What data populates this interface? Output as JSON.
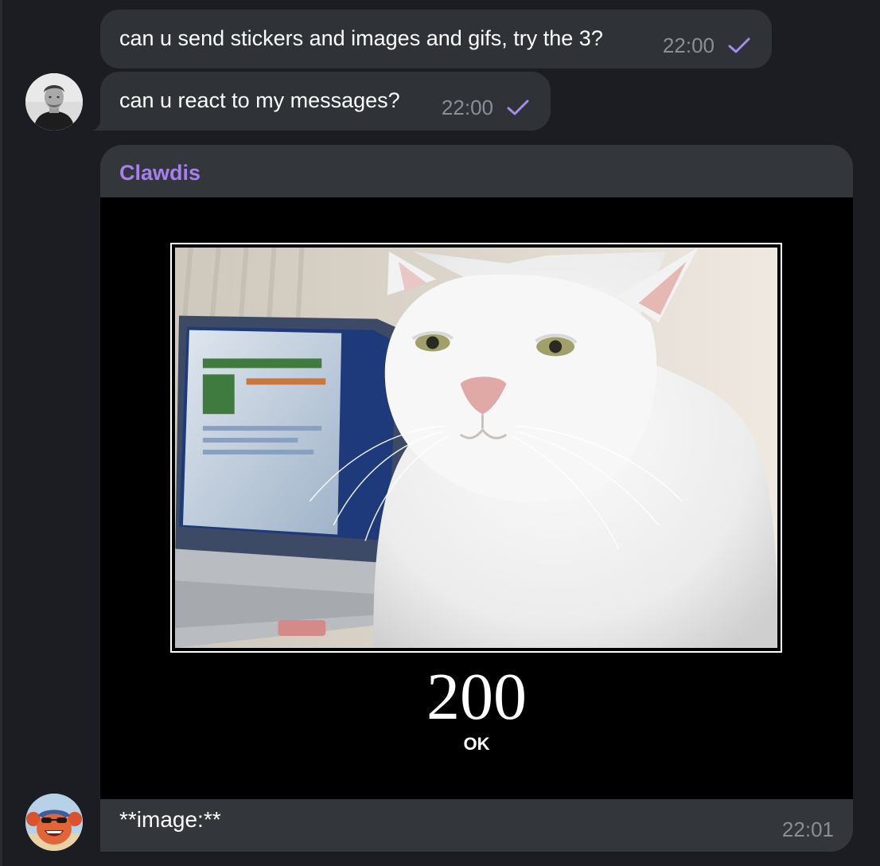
{
  "messages": {
    "msg1": {
      "text": "can u send stickers and images and gifs, try the 3?",
      "time": "22:00",
      "status": "read"
    },
    "msg2": {
      "text": "can u react to my messages?",
      "time": "22:00",
      "status": "read"
    },
    "bot": {
      "sender": "Clawdis",
      "image": {
        "title": "200",
        "subtitle": "OK"
      },
      "caption": "**image:**",
      "time": "22:01"
    }
  },
  "colors": {
    "background": "#1c1d22",
    "bubble": "#2f3237",
    "sender_name": "#a77ff0",
    "check": "#a78bf0",
    "timestamp": "#8a8e96"
  }
}
